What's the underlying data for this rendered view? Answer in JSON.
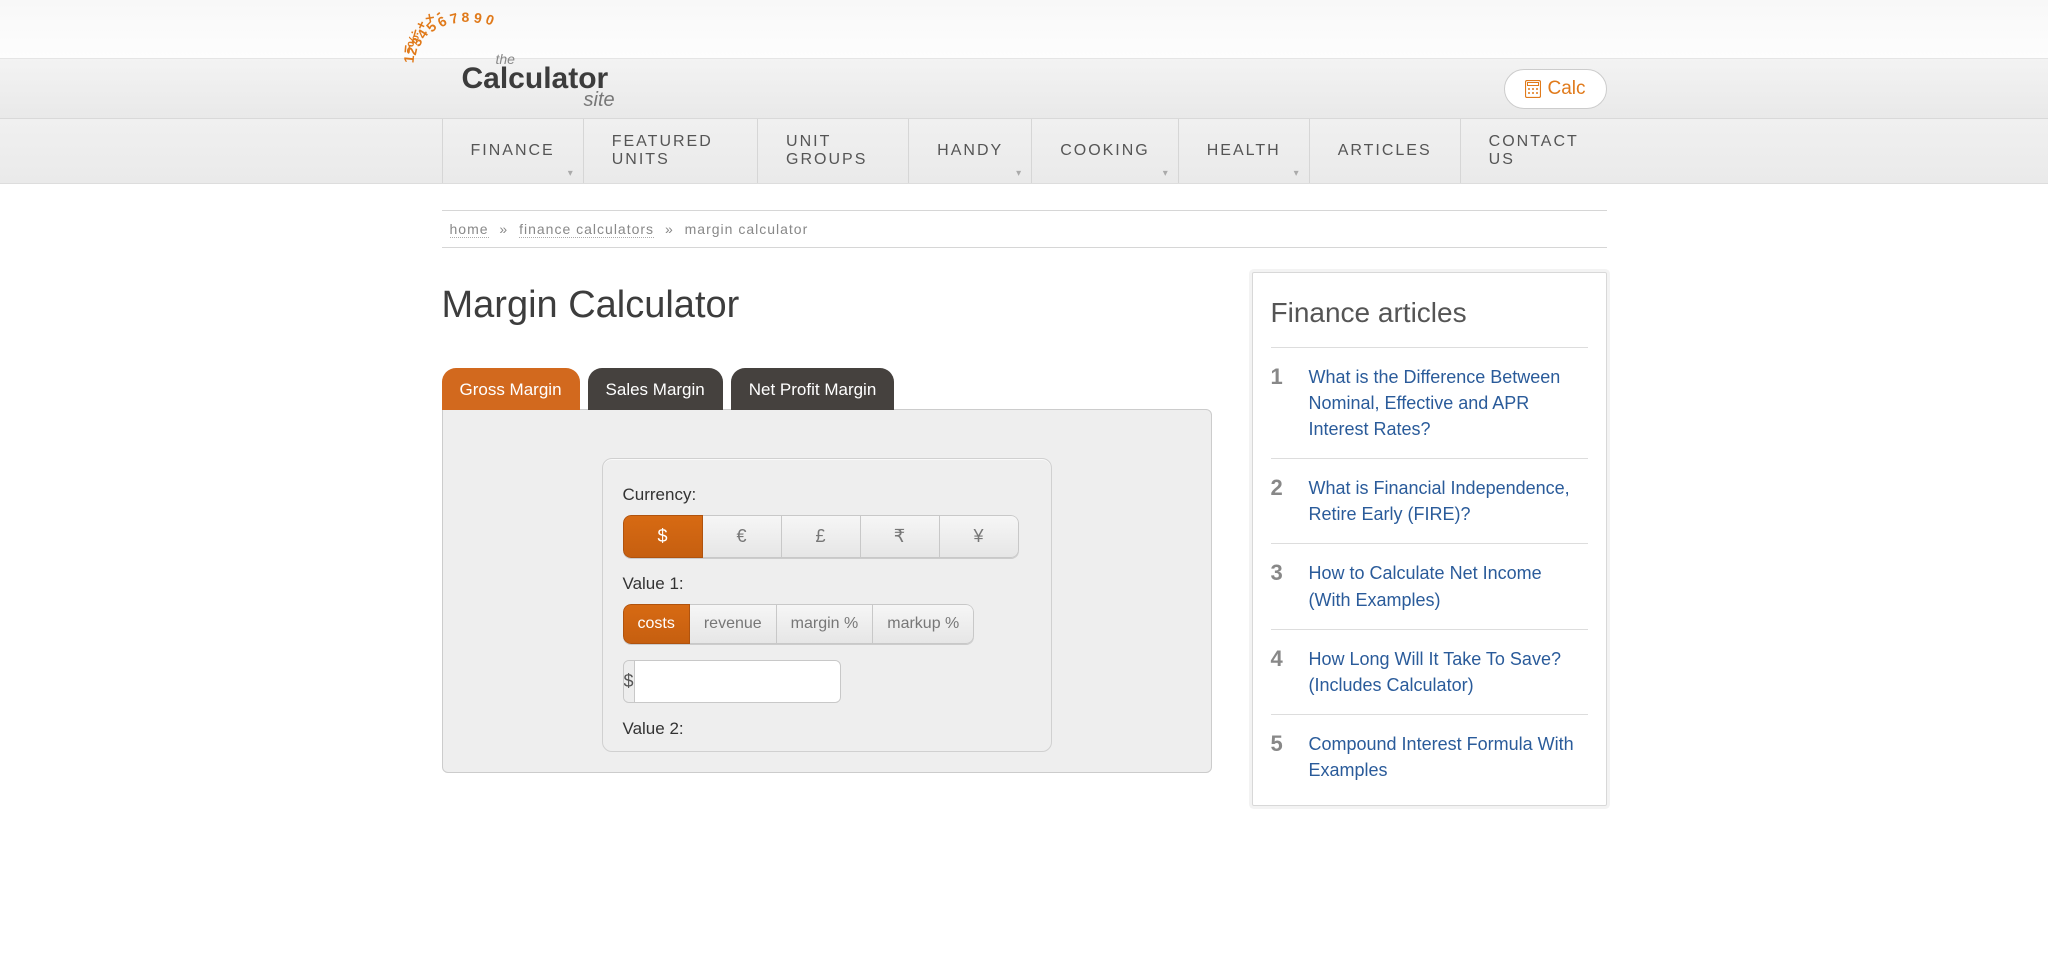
{
  "logo": {
    "the": "the",
    "calc": "Calculator",
    "site": "site"
  },
  "calc_button": {
    "label": "Calc"
  },
  "nav": [
    {
      "label": "FINANCE",
      "dropdown": true
    },
    {
      "label": "FEATURED UNITS",
      "dropdown": false
    },
    {
      "label": "UNIT GROUPS",
      "dropdown": false
    },
    {
      "label": "HANDY",
      "dropdown": true
    },
    {
      "label": "COOKING",
      "dropdown": true
    },
    {
      "label": "HEALTH",
      "dropdown": true
    },
    {
      "label": "ARTICLES",
      "dropdown": false
    },
    {
      "label": "CONTACT US",
      "dropdown": false
    }
  ],
  "breadcrumb": {
    "home": "home",
    "finance": "finance calculators",
    "current": "margin calculator",
    "sep": "»"
  },
  "page_title": "Margin Calculator",
  "tabs": [
    {
      "label": "Gross Margin",
      "active": true
    },
    {
      "label": "Sales Margin",
      "active": false
    },
    {
      "label": "Net Profit Margin",
      "active": false
    }
  ],
  "form": {
    "currency_label": "Currency:",
    "currencies": [
      {
        "label": "$",
        "active": true
      },
      {
        "label": "€",
        "active": false
      },
      {
        "label": "£",
        "active": false
      },
      {
        "label": "₹",
        "active": false
      },
      {
        "label": "¥",
        "active": false
      }
    ],
    "value1_label": "Value 1:",
    "value1_options": [
      {
        "label": "costs",
        "active": true
      },
      {
        "label": "revenue",
        "active": false
      },
      {
        "label": "margin %",
        "active": false
      },
      {
        "label": "markup %",
        "active": false
      }
    ],
    "value1_prefix": "$",
    "value1_value": "",
    "value2_label": "Value 2:"
  },
  "sidebar": {
    "title": "Finance articles",
    "articles": [
      {
        "num": "1",
        "title": "What is the Difference Between Nominal, Effective and APR Interest Rates?"
      },
      {
        "num": "2",
        "title": "What is Financial Independence, Retire Early (FIRE)?"
      },
      {
        "num": "3",
        "title": "How to Calculate Net Income (With Examples)"
      },
      {
        "num": "4",
        "title": "How Long Will It Take To Save? (Includes Calculator)"
      },
      {
        "num": "5",
        "title": "Compound Interest Formula With Examples"
      }
    ]
  }
}
